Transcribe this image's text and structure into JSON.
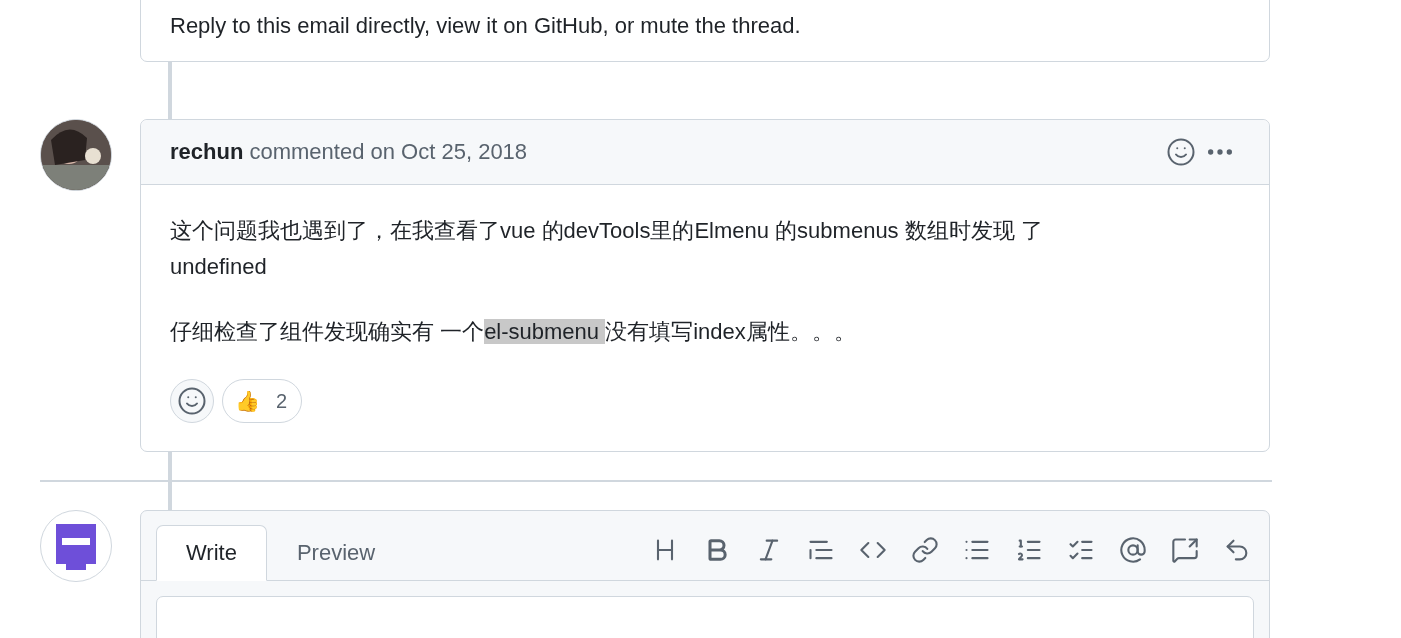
{
  "previous_comment": {
    "footer": "Reply to this email directly, view it on GitHub, or mute the thread."
  },
  "comment": {
    "author": "rechun",
    "meta": "commented on Oct 25, 2018",
    "paragraphs": [
      {
        "parts": [
          {
            "text": "这个问题我也遇到了，在我查看了vue 的devTools里的Elmenu 的submenus 数组时发现 了undefined",
            "highlighted": false
          }
        ]
      },
      {
        "parts": [
          {
            "text": "仔细检查了组件发现确实有 一个",
            "highlighted": false
          },
          {
            "text": "el-submenu ",
            "highlighted": true
          },
          {
            "text": "没有填写index属性。。。",
            "highlighted": false
          }
        ]
      }
    ],
    "reactions": [
      {
        "emoji": "👍",
        "count": "2"
      }
    ]
  },
  "editor": {
    "tabs": [
      {
        "label": "Write",
        "selected": true
      },
      {
        "label": "Preview",
        "selected": false
      }
    ],
    "toolbar": [
      {
        "kind": "heading"
      },
      {
        "kind": "bold"
      },
      {
        "kind": "italic"
      },
      {
        "kind": "quote"
      },
      {
        "kind": "code"
      },
      {
        "kind": "link"
      },
      {
        "kind": "bulleted-list"
      },
      {
        "kind": "numbered-list"
      },
      {
        "kind": "task-list"
      },
      {
        "kind": "mention"
      },
      {
        "kind": "reference"
      },
      {
        "kind": "reply"
      }
    ]
  }
}
